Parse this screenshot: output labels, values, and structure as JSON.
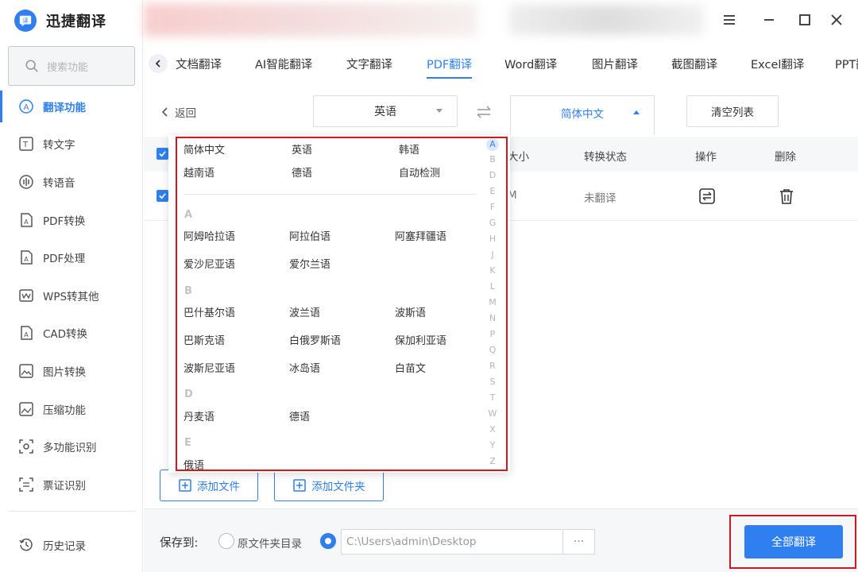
{
  "app": {
    "name": "迅捷翻译"
  },
  "colors": {
    "accent": "#2f7ff0",
    "highlight": "#d0181e"
  },
  "sidebar": {
    "search_placeholder": "搜索功能",
    "items": [
      {
        "label": "翻译功能",
        "icon": "translate-icon",
        "active": true
      },
      {
        "label": "转文字",
        "icon": "text-convert-icon"
      },
      {
        "label": "转语音",
        "icon": "voice-icon"
      },
      {
        "label": "PDF转换",
        "icon": "pdf-convert-icon"
      },
      {
        "label": "PDF处理",
        "icon": "pdf-process-icon"
      },
      {
        "label": "WPS转其他",
        "icon": "wps-icon"
      },
      {
        "label": "CAD转换",
        "icon": "cad-icon"
      },
      {
        "label": "图片转换",
        "icon": "image-convert-icon"
      },
      {
        "label": "压缩功能",
        "icon": "compress-icon"
      },
      {
        "label": "多功能识别",
        "icon": "recognize-icon"
      },
      {
        "label": "票证识别",
        "icon": "ticket-icon"
      }
    ],
    "history_label": "历史记录"
  },
  "tabs": [
    "文档翻译",
    "AI智能翻译",
    "文字翻译",
    "PDF翻译",
    "Word翻译",
    "图片翻译",
    "截图翻译",
    "Excel翻译",
    "PPT翻译"
  ],
  "active_tab": "PDF翻译",
  "toolbar": {
    "back_label": "返回",
    "source_lang": "英语",
    "target_lang": "简体中文",
    "clear_label": "清空列表"
  },
  "table": {
    "headers": {
      "size": "大小",
      "status": "转换状态",
      "action": "操作",
      "delete": "删除"
    },
    "row": {
      "size_fragment": "M",
      "status": "未翻译"
    }
  },
  "dropdown": {
    "common": [
      "简体中文",
      "英语",
      "韩语",
      "越南语",
      "德语",
      "自动检测"
    ],
    "groups": [
      {
        "letter": "A",
        "langs": [
          "阿姆哈拉语",
          "阿拉伯语",
          "阿塞拜疆语",
          "爱沙尼亚语",
          "爱尔兰语"
        ]
      },
      {
        "letter": "B",
        "langs": [
          "巴什基尔语",
          "波兰语",
          "波斯语",
          "巴斯克语",
          "白俄罗斯语",
          "保加利亚语",
          "波斯尼亚语",
          "冰岛语",
          "白苗文"
        ]
      },
      {
        "letter": "D",
        "langs": [
          "丹麦语",
          "德语"
        ]
      },
      {
        "letter": "E",
        "langs": [
          "俄语"
        ]
      }
    ],
    "alphabet": [
      "A",
      "B",
      "D",
      "E",
      "F",
      "G",
      "H",
      "J",
      "K",
      "L",
      "M",
      "N",
      "P",
      "Q",
      "R",
      "S",
      "T",
      "W",
      "X",
      "Y",
      "Z"
    ]
  },
  "add": {
    "file_label": "添加文件",
    "folder_label": "添加文件夹"
  },
  "footer": {
    "save_to_label": "保存到:",
    "option_source_dir": "原文件夹目录",
    "path": "C:\\Users\\admin\\Desktop",
    "browse_label": "···",
    "translate_all_label": "全部翻译"
  }
}
